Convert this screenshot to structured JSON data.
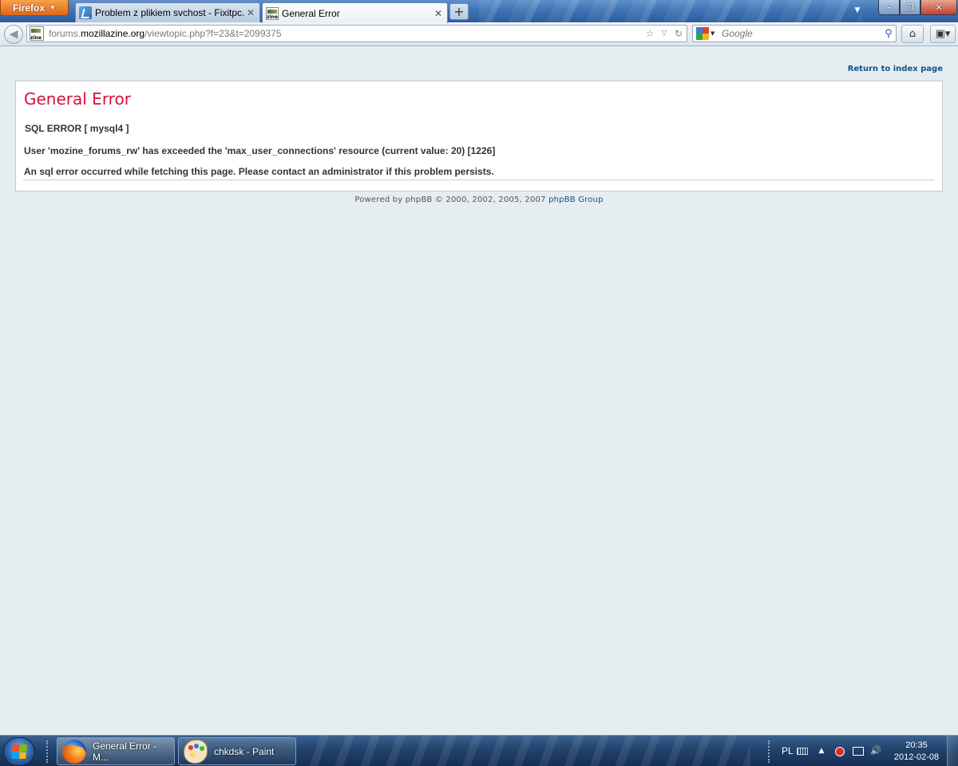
{
  "browser": {
    "menu_button": "Firefox",
    "tabs": [
      {
        "title": "Problem z plikiem svchost - Fixitpc.pl",
        "active": false
      },
      {
        "title": "General Error",
        "active": true
      }
    ],
    "new_tab_glyph": "+",
    "window_controls": {
      "minimize": "–",
      "maximize": "❐",
      "close": "✕"
    }
  },
  "navigation": {
    "url_prefix": "forums.",
    "url_domain": "mozillazine.org",
    "url_path": "/viewtopic.php?f=23&t=2099375",
    "search_placeholder": "Google",
    "search_engine_icon": "google-icon"
  },
  "page": {
    "return_link": "Return to index page",
    "title": "General Error",
    "sql_error": "SQL ERROR [ mysql4 ]",
    "user_error": "User 'mozine_forums_rw' has exceeded the 'max_user_connections' resource (current value: 20) [1226]",
    "admin_message": "An sql error occurred while fetching this page. Please contact an administrator if this problem persists.",
    "footer_text": "Powered by phpBB © 2000, 2002, 2005, 2007 ",
    "footer_link": "phpBB Group",
    "colors": {
      "title": "#d31141",
      "link": "#105289",
      "background": "#e6edf0"
    }
  },
  "taskbar": {
    "items": [
      {
        "label": "General Error - M...",
        "icon": "firefox-icon",
        "active": true
      },
      {
        "label": "chkdsk - Paint",
        "icon": "paint-icon",
        "active": false
      }
    ],
    "language": "PL",
    "time": "20:35",
    "date": "2012-02-08"
  }
}
